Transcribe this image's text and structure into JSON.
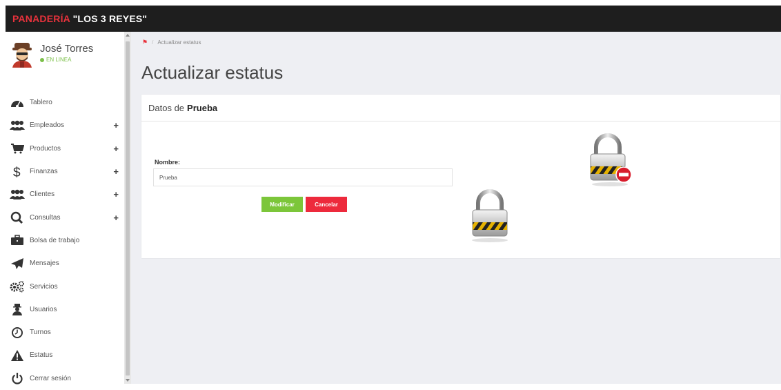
{
  "brand": {
    "part1": "PANADERÍA",
    "part2": "\"LOS 3 REYES\""
  },
  "user": {
    "name": "José Torres",
    "status": "EN LINEA"
  },
  "menu": [
    {
      "label": "Tablero",
      "icon": "tachometer-icon",
      "expandable": false
    },
    {
      "label": "Empleados",
      "icon": "users-icon",
      "expandable": true
    },
    {
      "label": "Productos",
      "icon": "cart-icon",
      "expandable": true
    },
    {
      "label": "Finanzas",
      "icon": "dollar-icon",
      "expandable": true
    },
    {
      "label": "Clientes",
      "icon": "users-icon",
      "expandable": true
    },
    {
      "label": "Consultas",
      "icon": "search-icon",
      "expandable": true
    },
    {
      "label": "Bolsa de trabajo",
      "icon": "briefcase-icon",
      "expandable": false
    },
    {
      "label": "Mensajes",
      "icon": "paper-plane-icon",
      "expandable": false
    },
    {
      "label": "Servicios",
      "icon": "cogs-icon",
      "expandable": false
    },
    {
      "label": "Usuarios",
      "icon": "user-secret-icon",
      "expandable": false
    },
    {
      "label": "Turnos",
      "icon": "clock-icon",
      "expandable": false
    },
    {
      "label": "Estatus",
      "icon": "warning-icon",
      "expandable": false
    },
    {
      "label": "Cerrar sesión",
      "icon": "power-icon",
      "expandable": false
    }
  ],
  "expand_symbol": "+",
  "breadcrumb": {
    "current": "Actualizar estatus"
  },
  "page": {
    "title": "Actualizar estatus"
  },
  "card": {
    "header_prefix": "Datos de",
    "header_name": "Prueba",
    "field_label": "Nombre:",
    "field_value": "Prueba",
    "save_label": "Modificar",
    "cancel_label": "Cancelar"
  },
  "colors": {
    "accent_red": "#e8323c",
    "online_green": "#7cc04a",
    "button_green": "#7cc63a",
    "button_red": "#ed2a3c",
    "topbar": "#1e1e1e"
  }
}
